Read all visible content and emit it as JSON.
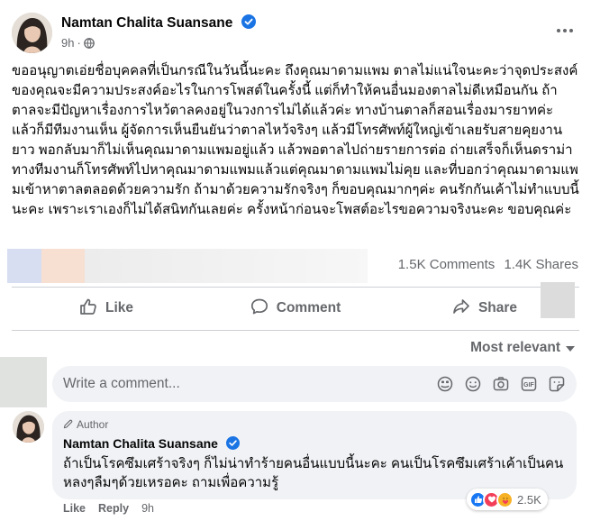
{
  "post": {
    "author": "Namtan Chalita Suansane",
    "time": "9h",
    "body": "ขออนุญาตเอ่ยชื่อบุคคลที่เป็นกรณีในวันนี้นะคะ ถึงคุณมาดามแพม ตาลไม่แน่ใจนะคะว่าจุดประสงค์ของคุณจะมีความประสงค์อะไรในการโพสต์ในครั้งนี้ แต่ก็ทำให้คนอื่นมองตาลไม่ดีเหมือนกัน ถ้าตาลจะมีปัญหาเรื่องการไหว้ตาลคงอยู่ในวงการไม่ได้แล้วค่ะ ทางบ้านตาลก็สอนเรื่องมารยาทค่ะ แล้วก็มีทีมงานเห็น ผู้จัดการเห็นยืนยันว่าตาลไหว้จริงๆ แล้วมีโทรศัพท์ผู้ใหญ่เข้าเลยรับสายคุยงานยาว พอกลับมาก็ไม่เห็นคุณมาดามแพมอยู่แล้ว แล้วพอตาลไปถ่ายรายการต่อ ถ่ายเสร็จก็เห็นดราม่า ทางทีมงานก็โทรศัพท์ไปหาคุณมาดามแพมแล้วแต่คุณมาดามแพมไม่คุย และที่บอกว่าคุณมาดามแพมเข้าหาตาลตลอดด้วยความรัก ถ้ามาด้วยความรักจริงๆ ก็ขอบคุณมากๆค่ะ คนรักกันเค้าไม่ทำแบบนี้นะคะ เพราะเราเองก็ไม่ได้สนิทกันเลยค่ะ ครั้งหน้าก่อนจะโพสต์อะไรขอความจริงนะคะ ขอบคุณค่ะ",
    "comments_count": "1.5K Comments",
    "shares_count": "1.4K Shares"
  },
  "actions": {
    "like": "Like",
    "comment": "Comment",
    "share": "Share"
  },
  "sort_label": "Most relevant",
  "comment_input": {
    "placeholder": "Write a comment..."
  },
  "top_comment": {
    "badge": "Author",
    "author": "Namtan Chalita Suansane",
    "text": "ถ้าเป็นโรคซึมเศร้าจริงๆ ก็ไม่น่าทำร้ายคนอื่นแบบนี้นะคะ คนเป็นโรคซึมเศร้าเค้าเป็นคนหลงๆลืมๆด้วยเหรอคะ ถามเพื่อความรู้",
    "like_label": "Like",
    "reply_label": "Reply",
    "time": "9h",
    "reaction_count": "2.5K",
    "reaction_icons": [
      "like-icon",
      "love-icon",
      "care-icon"
    ]
  },
  "colors": {
    "text_primary": "#050505",
    "text_secondary": "#65676b",
    "verified_blue": "#1b74e4",
    "input_bg": "#f0f2f5",
    "divider": "#ced0d4"
  }
}
